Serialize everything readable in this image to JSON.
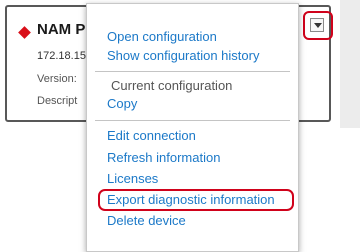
{
  "device": {
    "name": "NAM P",
    "ip": "172.18.15",
    "version_label": "Version:",
    "description_label": "Descript",
    "status_color": "#d90f19"
  },
  "menu_button": {
    "icon": "chevron-down-icon"
  },
  "menu": {
    "open_configuration": "Open configuration",
    "show_configuration_history": "Show configuration history",
    "current_configuration_label": "Current configuration",
    "copy": "Copy",
    "edit_connection": "Edit connection",
    "refresh_information": "Refresh information",
    "licenses": "Licenses",
    "export_diagnostic_information": "Export diagnostic information",
    "delete_device": "Delete device"
  },
  "colors": {
    "link": "#1c79c8",
    "highlight": "#d0021b"
  }
}
